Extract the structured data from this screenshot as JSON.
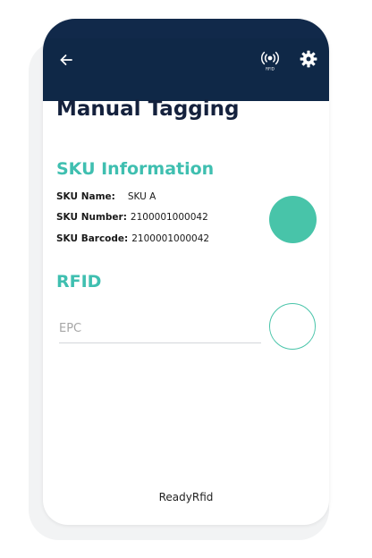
{
  "header": {
    "back_icon": "arrow-left-icon",
    "rfid_icon": "rfid-broadcast-icon",
    "rfid_icon_caption": "RFID",
    "settings_icon": "gear-icon",
    "background_color": "#0f2847"
  },
  "page": {
    "title": "Manual Tagging"
  },
  "sku": {
    "section_title": "SKU Information",
    "name_label": "SKU Name:",
    "name_value": "SKU A",
    "number_label": "SKU Number:",
    "number_value": "2100001000042",
    "barcode_label": "SKU Barcode:",
    "barcode_value": "2100001000042",
    "status_color": "#48c4a9"
  },
  "rfid": {
    "section_title": "RFID",
    "epc_placeholder": "EPC",
    "epc_value": ""
  },
  "footer": {
    "brand": "ReadyRfid"
  },
  "colors": {
    "accent": "#3fbfb0",
    "title": "#14213d"
  }
}
